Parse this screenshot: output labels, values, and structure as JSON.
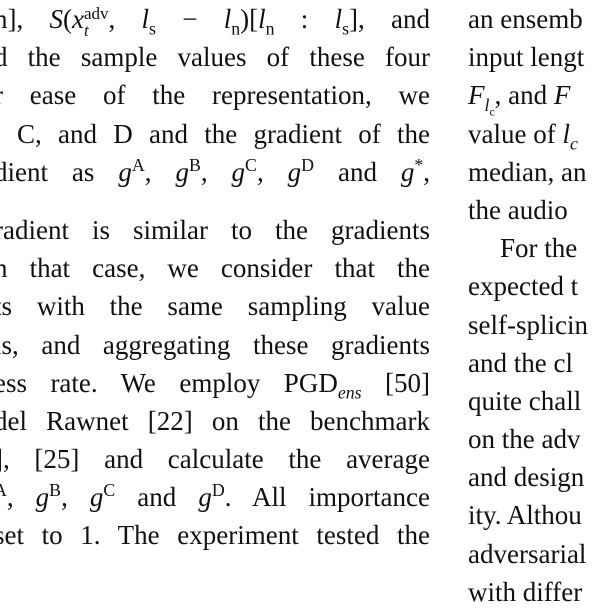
{
  "left_column": [
    {
      "id": "l1",
      "text": "n], S(x_t^adv, l_s − l_n)[l_n : l_s], and"
    },
    {
      "id": "l2",
      "text": "d the sample values of these four"
    },
    {
      "id": "l3",
      "text": "r ease of the representation, we"
    },
    {
      "id": "l4",
      "text": ", C, and D and the gradient of the"
    },
    {
      "id": "l5",
      "text": "dient as g^A, g^B, g^C, g^D and g*,"
    },
    {
      "id": "l6",
      "text": "radient is similar to the gradients"
    },
    {
      "id": "l7",
      "text": "n that case, we consider that the"
    },
    {
      "id": "l8",
      "text": "ts with the same sampling value"
    },
    {
      "id": "l9",
      "text": "ls, and aggregating these gradients"
    },
    {
      "id": "l10",
      "text": "ess rate. We employ PGD_ens [50]"
    },
    {
      "id": "l11",
      "text": "del Rawnet [22] on the benchmark"
    },
    {
      "id": "l12",
      "text": "], [25] and calculate the average"
    },
    {
      "id": "l13",
      "text": "A, g^B, g^C and g^D. All importance"
    },
    {
      "id": "l14",
      "text": "set to 1. The experiment tested the"
    }
  ],
  "right_column": [
    {
      "id": "r1",
      "text": "an ensemb"
    },
    {
      "id": "r2",
      "text": "input lengt"
    },
    {
      "id": "r3",
      "text": "F_lc, and F"
    },
    {
      "id": "r4",
      "text": "value of l_c"
    },
    {
      "id": "r5",
      "text": "median, an"
    },
    {
      "id": "r6",
      "text": "the audio"
    },
    {
      "id": "r7",
      "text": "For the"
    },
    {
      "id": "r8",
      "text": "expected t"
    },
    {
      "id": "r9",
      "text": "self-splicin"
    },
    {
      "id": "r10",
      "text": "and the cl"
    },
    {
      "id": "r11",
      "text": "quite chall"
    },
    {
      "id": "r12",
      "text": "on the adv"
    },
    {
      "id": "r13",
      "text": "and design"
    },
    {
      "id": "r14",
      "text": "ity. Althou"
    },
    {
      "id": "r15",
      "text": "adversarial"
    },
    {
      "id": "r16",
      "text": "with differ"
    }
  ],
  "left_spans": {
    "l1a": "n], ",
    "l1b": "S",
    "l1c": "(",
    "l1d": "x",
    "l1e": "adv",
    "l1f": "t",
    "l1g": ", ",
    "l1h": "l",
    "l1i": "s",
    "l1j": " − ",
    "l1k": "l",
    "l1l": "n",
    "l1m": ")[",
    "l1n": "l",
    "l1o": "n",
    "l1p": " : ",
    "l1q": "l",
    "l1r": "s",
    "l1s": "], and",
    "l5a": "dient as ",
    "l5b": "g",
    "l5c": "A",
    "l5d": ", ",
    "l5e": "g",
    "l5f": "B",
    "l5g": ", ",
    "l5h": "g",
    "l5i": "C",
    "l5j": ", ",
    "l5k": "g",
    "l5l": "D",
    "l5m": " and ",
    "l5n": "g",
    "l5o": "*",
    "l5p": ",",
    "l10a": "ess rate. We employ PGD",
    "l10b": "ens",
    "l10c": " [50]",
    "l13a": "A",
    "l13b": ", ",
    "l13c": "g",
    "l13d": "B",
    "l13e": ", ",
    "l13f": "g",
    "l13g": "C",
    "l13h": " and ",
    "l13i": "g",
    "l13j": "D",
    "l13k": ". All importance"
  },
  "right_spans": {
    "r3a": "F",
    "r3b": "l",
    "r3c": "c",
    "r3d": ", and ",
    "r3e": "F",
    "r4a": "value of ",
    "r4b": "l",
    "r4c": "c"
  }
}
